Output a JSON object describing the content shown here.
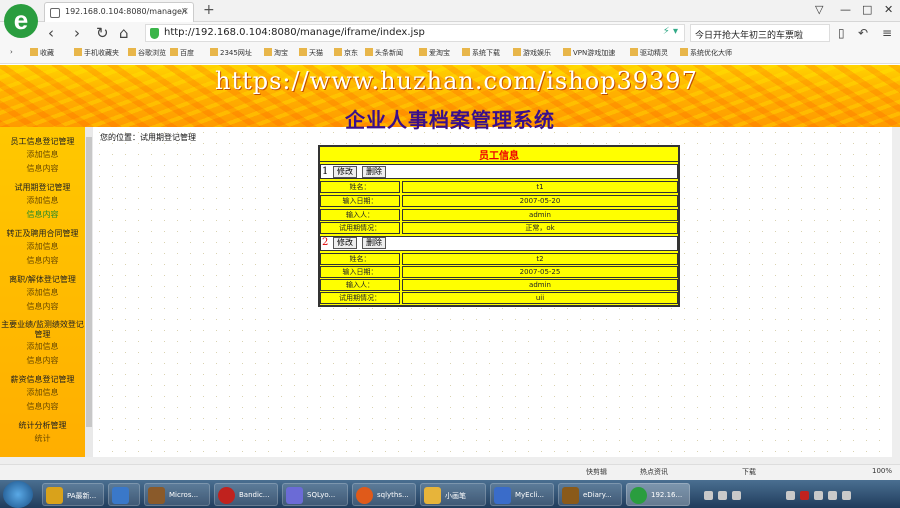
{
  "browser": {
    "logo": "e",
    "tab_title": "192.168.0.104:8080/manage/i",
    "url": "http://192.168.0.104:8080/manage/iframe/index.jsp",
    "search_text": "今日开抢大年初三的车票啦",
    "bookmarks": [
      "收藏",
      "手机收藏夹",
      "谷歌浏览",
      "网址",
      "百度",
      "2345网址",
      "淘宝",
      "天猫",
      "京东",
      "头条新闻",
      "爱淘宝",
      "系统下载",
      "游戏娱乐",
      "VPN游戏加速",
      "驱动精灵",
      "系统优化大师"
    ]
  },
  "banner": {
    "watermark": "https://www.huzhan.com/ishop39397",
    "system_title": "企业人事档案管理系统"
  },
  "sidebar": [
    {
      "heading": "员工信息登记管理",
      "links": [
        "添加信息",
        "信息内容"
      ]
    },
    {
      "heading": "试用期登记管理",
      "links": [
        "添加信息",
        "信息内容"
      ]
    },
    {
      "heading": "转正及聘用合同管理",
      "links": [
        "添加信息",
        "信息内容"
      ]
    },
    {
      "heading": "离职/解体登记管理",
      "links": [
        "添加信息",
        "信息内容"
      ]
    },
    {
      "heading": "主要业绩/监测绩效登记管理",
      "links": [
        "添加信息",
        "信息内容"
      ]
    },
    {
      "heading": "薪资信息登记管理",
      "links": [
        "添加信息",
        "信息内容"
      ]
    },
    {
      "heading": "统计分析管理",
      "links": [
        "统计"
      ]
    }
  ],
  "location": "您的位置：试用期登记管理",
  "panel": {
    "title": "员工信息",
    "edit_label": "修改",
    "delete_label": "删除",
    "field_labels": [
      "姓名：",
      "输入日期：",
      "输入人：",
      "试用期情况："
    ],
    "records": [
      {
        "num": "1",
        "values": [
          "t1",
          "2007-05-20",
          "admin",
          "正常，ok"
        ]
      },
      {
        "num": "2",
        "values": [
          "t2",
          "2007-05-25",
          "admin",
          "uii"
        ]
      }
    ]
  },
  "statusbar": [
    "快剪辑",
    "热点资讯",
    "下载",
    "100%"
  ],
  "taskbar": {
    "items": [
      "PA最新...",
      "",
      "Micros...",
      "Bandic...",
      "SQLyo...",
      "sqlyths...",
      "小画笔",
      "MyEcli...",
      "eDiary...",
      "192.16..."
    ],
    "clock": "",
    "colors": [
      "#d9a21b",
      "#3a78c9",
      "#8a5a2a",
      "#c0221e",
      "#6b6bd6",
      "#e05a1a",
      "#e7b43a",
      "#3a6cc9",
      "#8a5a1a",
      "#2a9d3f"
    ]
  }
}
